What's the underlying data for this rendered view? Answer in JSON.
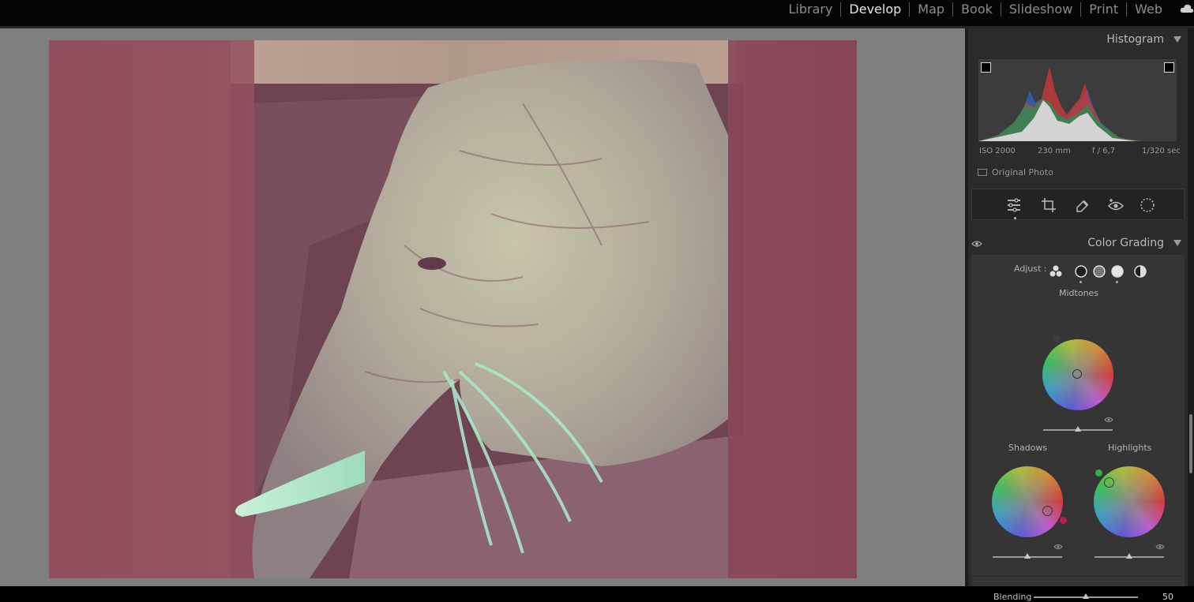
{
  "modules": [
    "Library",
    "Develop",
    "Map",
    "Book",
    "Slideshow",
    "Print",
    "Web"
  ],
  "active_module": "Develop",
  "histogram": {
    "title": "Histogram",
    "iso": "ISO 2000",
    "focal": "230 mm",
    "aperture": "f / 6,7",
    "shutter": "1/320 sec",
    "original_photo_label": "Original Photo"
  },
  "tools": [
    "edit-sliders-icon",
    "crop-icon",
    "healing-icon",
    "red-eye-icon",
    "masking-icon"
  ],
  "color_grading": {
    "title": "Color Grading",
    "adjust_label": "Adjust :",
    "midtones_label": "Midtones",
    "shadows_label": "Shadows",
    "highlights_label": "Highlights",
    "blending_label": "Blending",
    "blending_value": "50"
  },
  "colors": {
    "accent": "#e6e6e6",
    "panel_bg": "#353535",
    "canvas_bg": "#7f7f7f"
  }
}
